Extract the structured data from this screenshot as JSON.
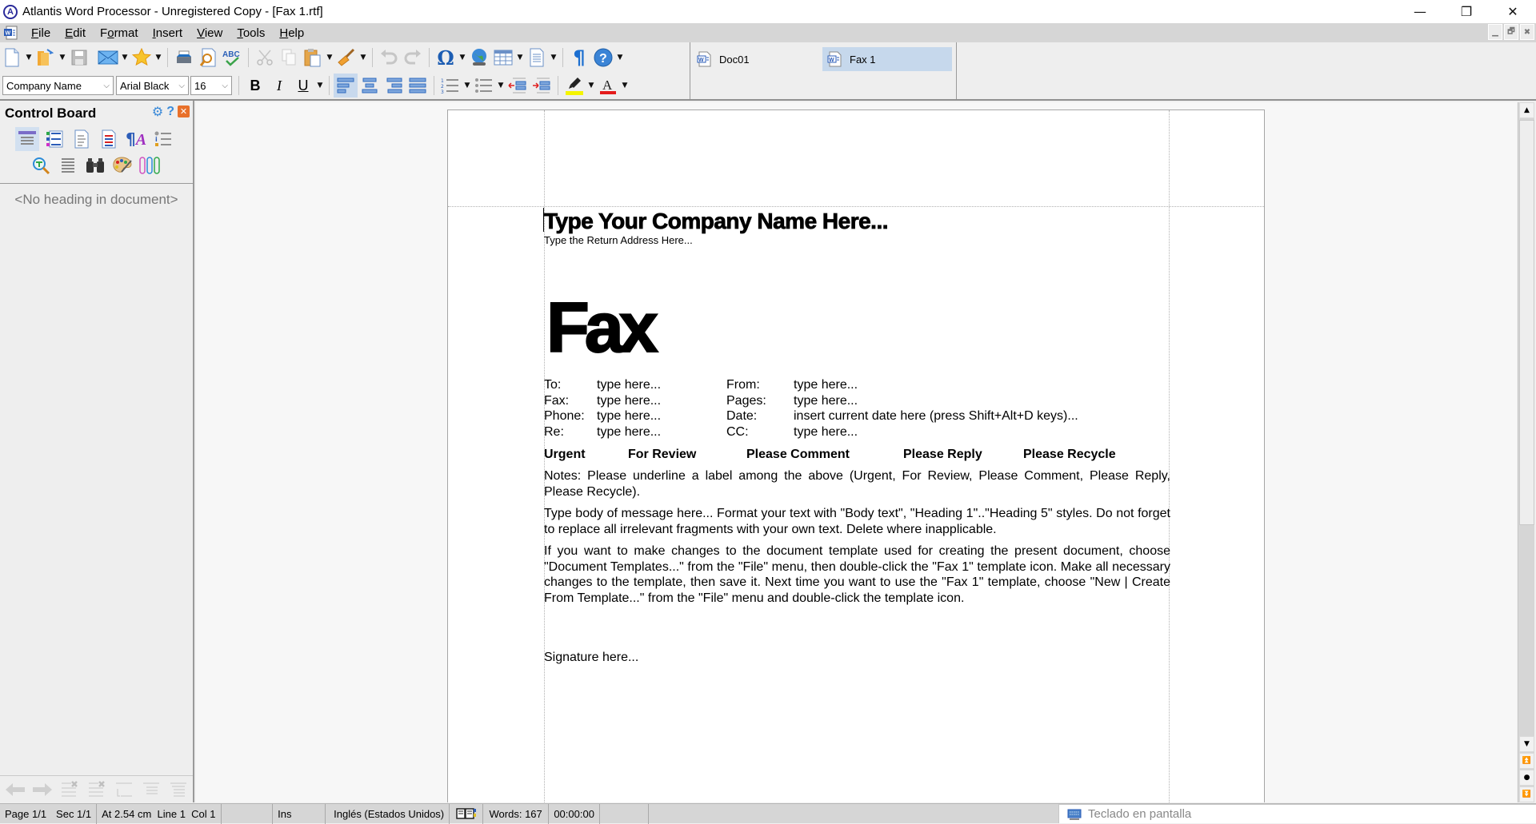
{
  "window": {
    "title": "Atlantis Word Processor - Unregistered Copy - [Fax 1.rtf]",
    "logo_letter": "A",
    "controls": {
      "minimize": "—",
      "restore": "❐",
      "close": "✕"
    }
  },
  "menubar": {
    "items": [
      {
        "label": "File",
        "accel": "F",
        "rest": "ile"
      },
      {
        "label": "Edit",
        "accel": "E",
        "rest": "dit"
      },
      {
        "label": "Format",
        "pre": "F",
        "accel": "o",
        "rest": "rmat"
      },
      {
        "label": "Insert",
        "accel": "I",
        "rest": "nsert"
      },
      {
        "label": "View",
        "accel": "V",
        "rest": "iew"
      },
      {
        "label": "Tools",
        "accel": "T",
        "rest": "ools"
      },
      {
        "label": "Help",
        "accel": "H",
        "rest": "elp"
      }
    ],
    "mdi_controls": {
      "minimize": "▁",
      "restore": "🗗",
      "close": "✖"
    }
  },
  "toolbar": {
    "style_combo": "Company Name",
    "font_combo": "Arial Black",
    "size_combo": "16",
    "bold": "B",
    "italic": "I",
    "underline": "U",
    "highlight_color": "#f5f500",
    "font_color": "#e41b1b"
  },
  "doc_tabs": [
    {
      "label": "Doc01",
      "active": false
    },
    {
      "label": "Fax 1",
      "active": true
    }
  ],
  "control_board": {
    "title": "Control Board",
    "empty_text": "<No heading in document>"
  },
  "document": {
    "company_name": "Type Your Company Name Here...",
    "return_address": "Type the Return Address Here...",
    "fax_title": "Fax",
    "fields": [
      {
        "l1": "To:",
        "v1": "type here...",
        "l2": "From:",
        "v2": "type here..."
      },
      {
        "l1": "Fax:",
        "v1": "type here...",
        "l2": "Pages:",
        "v2": "type here..."
      },
      {
        "l1": "Phone:",
        "v1": "type here...",
        "l2": "Date:",
        "v2": "insert current date here (press Shift+Alt+D keys)..."
      },
      {
        "l1": "Re:",
        "v1": "type here...",
        "l2": "CC:",
        "v2": "type here..."
      }
    ],
    "labels": [
      "Urgent",
      "For Review",
      "Please Comment",
      "Please Reply",
      "Please Recycle"
    ],
    "notes": "Notes: Please underline a label among the above (Urgent, For Review, Please Comment, Please Reply, Please Recycle).",
    "body": "Type body of message here... Format your text with \"Body text\", \"Heading 1\"..\"Heading 5\" styles. Do not forget to replace all irrelevant fragments with your own text. Delete where inapplicable.",
    "instructions": "If you want to make changes to the document template used for creating the present document, choose \"Document Templates...\" from the \"File\" menu, then double-click the \"Fax 1\" template icon. Make all necessary changes to the template, then save it. Next time you want to use the \"Fax 1\" template, choose \"New | Create From Template...\" from the \"File\" menu and double-click the template icon.",
    "signature": "Signature here..."
  },
  "statusbar": {
    "page": "Page 1/1",
    "section": "Sec 1/1",
    "position": "At 2.54 cm  Line 1  Col 1",
    "blank": "",
    "mode": "Ins",
    "language": "Inglés (Estados Unidos)",
    "words": "Words: 167",
    "timer": "00:00:00"
  },
  "keyboard_popup": {
    "label": "Teclado en pantalla"
  }
}
